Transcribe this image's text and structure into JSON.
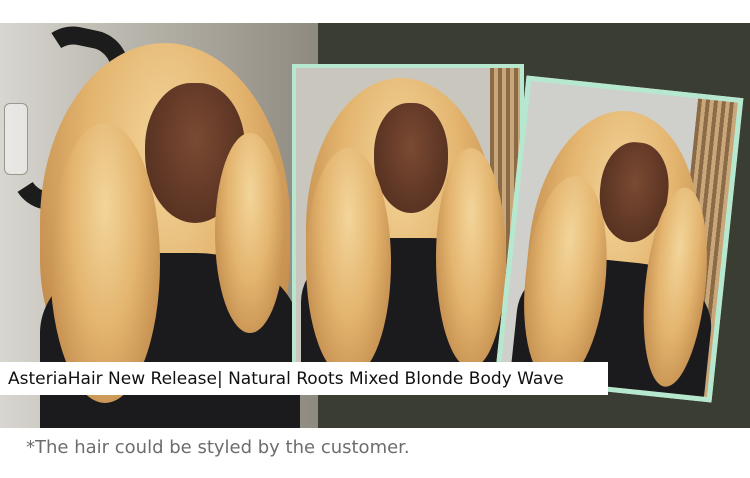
{
  "banner": {
    "caption": "AsteriaHair New Release| Natural Roots Mixed Blonde Body Wave",
    "background_color": "#3a3d32",
    "frame_color": "#b6e8cf"
  },
  "note": {
    "text": "*The hair could be styled by the customer."
  }
}
